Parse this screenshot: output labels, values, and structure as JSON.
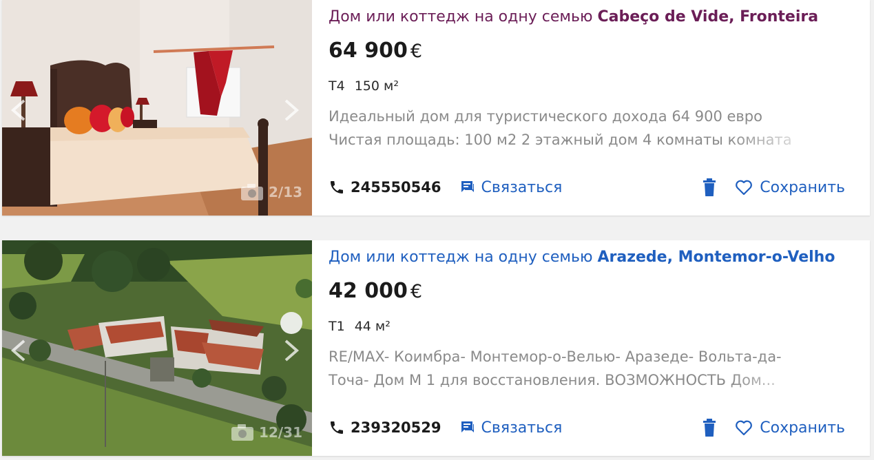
{
  "listings": [
    {
      "title_prefix": "Дом или коттедж на одну семью ",
      "title_location": "Cabeço de Vide, Fronteira",
      "price": "64 900",
      "currency": "€",
      "rooms": "T4",
      "area": "150 м²",
      "desc_line1": "Идеальный дом для туристического дохода 64 900 евро",
      "desc_line2": "Чистая площадь: 100 м2 2 этажный дом 4 комнаты комната",
      "phone": "245550546",
      "contact_label": "Связаться",
      "save_label": "Сохранить",
      "photo_counter": "2/13",
      "title_color": "#6b1e57"
    },
    {
      "title_prefix": "Дом или коттедж на одну семью ",
      "title_location": "Arazede, Montemor-o-Velho",
      "price": "42 000",
      "currency": "€",
      "rooms": "T1",
      "area": "44 м²",
      "desc_line1": "RE/MAX- Коимбра- Монтемор-о-Велью- Аразеде- Вольта-да-",
      "desc_line2": "Точа- Дом М 1 для восстановления. ВОЗМОЖНОСТЬ Дом...",
      "phone": "239320529",
      "contact_label": "Связаться",
      "save_label": "Сохранить",
      "photo_counter": "12/31",
      "title_color": "#1f5fbf"
    }
  ],
  "icons": {
    "phone": "phone-icon",
    "contact": "chat-icon",
    "delete": "trash-icon",
    "save": "heart-icon",
    "camera": "camera-icon",
    "prev": "chevron-left-icon",
    "next": "chevron-right-icon"
  },
  "colors": {
    "link_blue": "#1f5fbf",
    "visited_purple": "#6b1e57",
    "text_dark": "#1b1b1b",
    "text_muted": "#8a8a8a"
  }
}
